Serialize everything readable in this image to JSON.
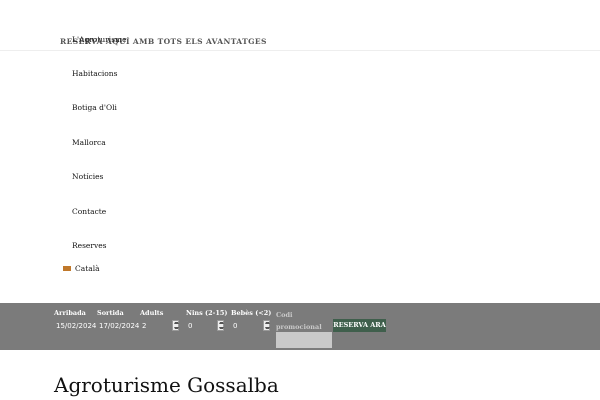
{
  "top_promo": "RESERVA AQUÍ AMB TOTS ELS AVANTATGES",
  "nav": {
    "items": [
      {
        "label": "L'Agroturisme"
      },
      {
        "label": "Habitacions"
      },
      {
        "label": "Botiga d'Oli"
      },
      {
        "label": "Mallorca"
      },
      {
        "label": "Notícies"
      },
      {
        "label": "Contacte"
      },
      {
        "label": "Reserves"
      }
    ],
    "language": "Català"
  },
  "booking": {
    "arrival_label": "Arribada",
    "arrival_value": "15/02/2024",
    "departure_label": "Sortida",
    "departure_value": "17/02/2024",
    "adults_label": "Adults",
    "adults_value": "2",
    "children_label": "Nins (2-15)",
    "children_value": "0",
    "babies_label": "Bebès (<2)",
    "babies_value": "0",
    "promo_label": "Codi promocional",
    "promo_value": "",
    "button_label": "RESERVA ARA"
  },
  "page_title": "Agroturisme Gossalba",
  "colors": {
    "booking_bar": "#7b7b7b",
    "button": "#3f5f4c",
    "flag": "#c0782a"
  }
}
